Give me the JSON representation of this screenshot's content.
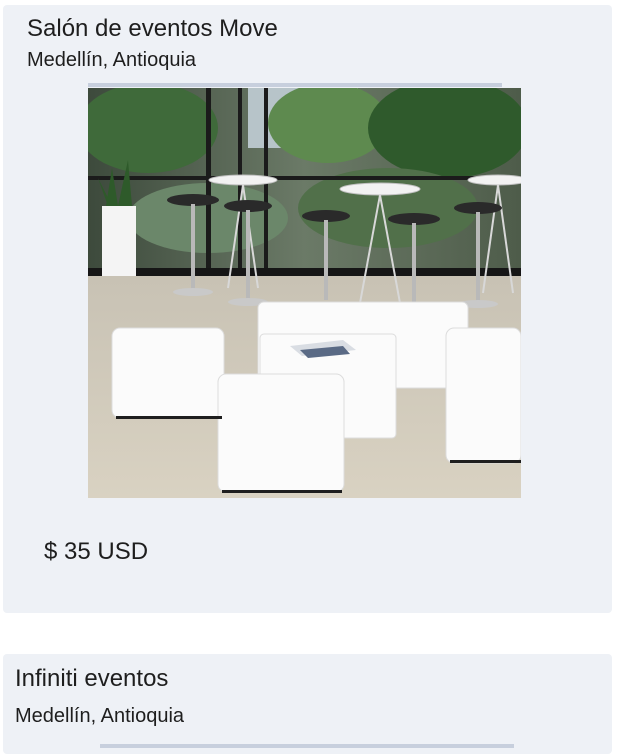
{
  "listings": [
    {
      "name": "Salón de eventos Move",
      "location": "Medellín, Antioquia",
      "price": "$ 35 USD",
      "image": "event-lounge-photo"
    },
    {
      "name": "Infiniti eventos",
      "location": "Medellín, Antioquia"
    }
  ],
  "colors": {
    "card_background": "#eef1f6",
    "page_background": "#ffffff",
    "text": "#1e1e1e",
    "image_placeholder_line": "#c7cfdd"
  }
}
